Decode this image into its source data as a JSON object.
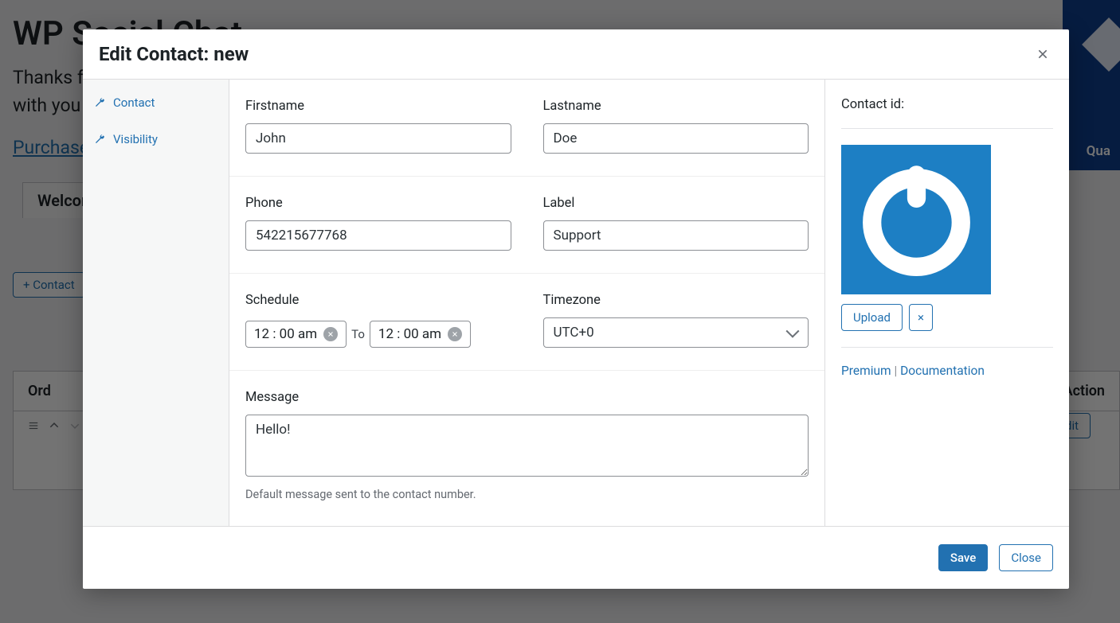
{
  "page": {
    "title": "WP Social Chat",
    "thanks_prefix": "Thanks fo",
    "thanks_line2": "with you",
    "purchase_link": "Purchase",
    "welcome_tab": "Welcom",
    "add_contact": "+ Contact",
    "table": {
      "order_header": "Ord",
      "action_header": "Action",
      "edit_button": "Edit"
    },
    "right_promo": "Qua"
  },
  "modal": {
    "title": "Edit Contact: new",
    "sidebar": {
      "items": [
        {
          "label": "Contact"
        },
        {
          "label": "Visibility"
        }
      ]
    },
    "form": {
      "firstname_label": "Firstname",
      "firstname_value": "John",
      "lastname_label": "Lastname",
      "lastname_value": "Doe",
      "phone_label": "Phone",
      "phone_value": "542215677768",
      "label_label": "Label",
      "label_value": "Support",
      "schedule_label": "Schedule",
      "schedule_from": "12 : 00   am",
      "schedule_to_word": "To",
      "schedule_to": "12 : 00   am",
      "timezone_label": "Timezone",
      "timezone_value": "UTC+0",
      "message_label": "Message",
      "message_value": "Hello!",
      "message_helper": "Default message sent to the contact number."
    },
    "right": {
      "contact_id_label": "Contact id:",
      "upload_label": "Upload",
      "remove_label": "×",
      "premium_label": "Premium",
      "sep": " | ",
      "docs_label": "Documentation"
    },
    "footer": {
      "save_label": "Save",
      "close_label": "Close"
    }
  }
}
